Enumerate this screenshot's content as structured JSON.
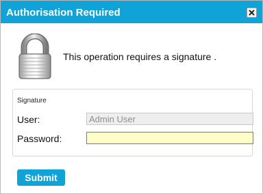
{
  "dialog": {
    "title": "Authorisation Required",
    "close_glyph": "✖",
    "close_icon": "close-icon",
    "lock_icon": "padlock-icon",
    "message": "This operation requires a signature ."
  },
  "signature": {
    "legend": "Signature",
    "user_label": "User:",
    "user_value": "Admin User",
    "password_label": "Password:",
    "password_value": ""
  },
  "actions": {
    "submit_label": "Submit"
  },
  "colors": {
    "accent": "#0fa3d8",
    "password_bg": "#ffffc8"
  }
}
